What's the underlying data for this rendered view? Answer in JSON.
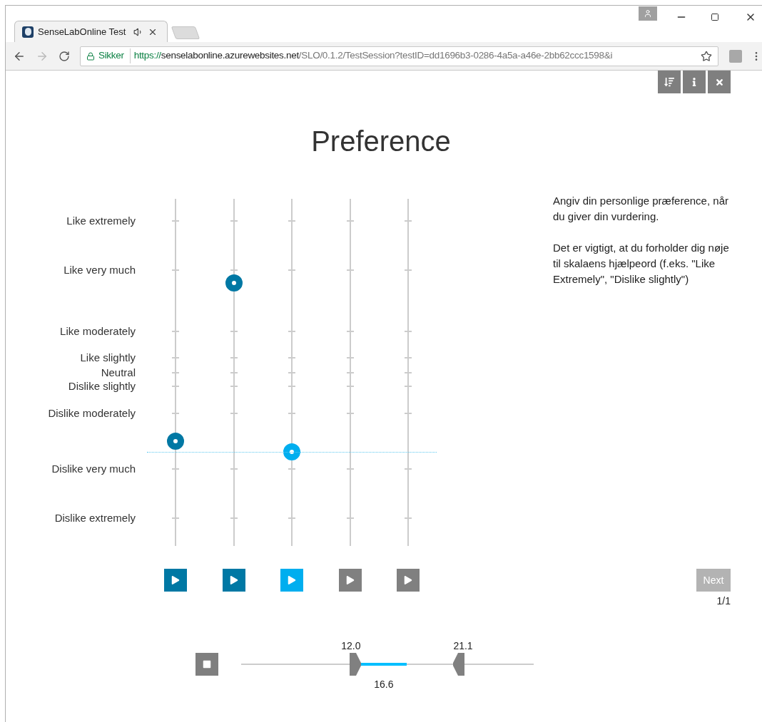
{
  "browser": {
    "tab_title": "SenseLabOnline Test",
    "security": "Sikker",
    "url": {
      "scheme": "https://",
      "host": "senselabonline.azurewebsites.net",
      "path": "/SLO/0.1.2/TestSession?testID=dd1696b3-0286-4a5a-a46e-2bb62ccc1598&i"
    }
  },
  "title": "Preference",
  "scale_labels": [
    "Like extremely",
    "Like very much",
    "Like moderately",
    "Like slightly",
    "Neutral",
    "Dislike slightly",
    "Dislike moderately",
    "Dislike very much",
    "Dislike extremely"
  ],
  "samples": [
    {
      "selected": false,
      "rated": true,
      "level": 0.302
    },
    {
      "selected": false,
      "rated": true,
      "level": 0.758
    },
    {
      "selected": true,
      "rated": true,
      "level": 0.271
    },
    {
      "selected": false,
      "rated": false
    },
    {
      "selected": false,
      "rated": false
    }
  ],
  "instructions": [
    "Angiv din personlige præference, når du giver din vurdering.",
    "Det er vigtigt, at du forholder dig nøje til skalaens hjælpeord (f.eks. \"Like Extremely\", \"Dislike slightly\")"
  ],
  "next": {
    "label": "Next",
    "disabled": true
  },
  "progress": "1/1",
  "range": {
    "start": {
      "label": "12.0",
      "level": 0.39
    },
    "end": {
      "label": "21.1",
      "level": 0.744
    },
    "position": {
      "label": "16.6"
    }
  }
}
